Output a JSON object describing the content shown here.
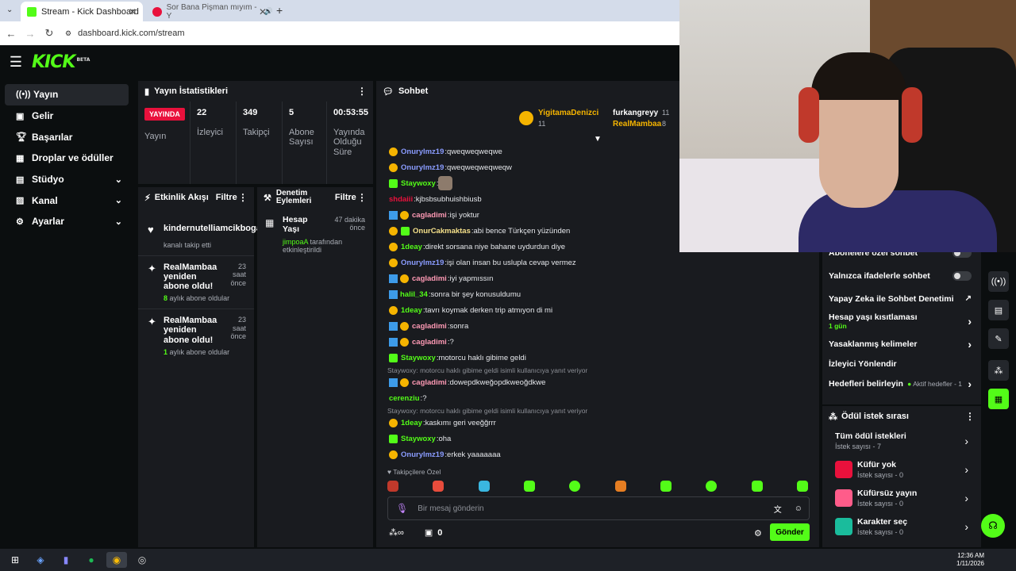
{
  "browser": {
    "tabs": [
      {
        "title": "Stream - Kick Dashboard",
        "active": true
      },
      {
        "title": "Sor Bana Pişman mıyım - Y",
        "active": false
      }
    ],
    "url": "dashboard.kick.com/stream"
  },
  "header": {
    "logo": "KICK",
    "beta": "BETA"
  },
  "sidebar": {
    "items": [
      {
        "label": "Yayın",
        "icon": "broadcast-icon",
        "active": true
      },
      {
        "label": "Gelir",
        "icon": "revenue-icon"
      },
      {
        "label": "Başarılar",
        "icon": "trophy-icon"
      },
      {
        "label": "Droplar ve ödüller",
        "icon": "gift-icon"
      },
      {
        "label": "Stüdyo",
        "icon": "studio-icon",
        "expand": true
      },
      {
        "label": "Kanal",
        "icon": "channel-icon",
        "expand": true
      },
      {
        "label": "Ayarlar",
        "icon": "gear-icon",
        "expand": true
      }
    ]
  },
  "stream_stats": {
    "title": "Yayın İstatistikleri",
    "live": "YAYINDA",
    "live_label": "Yayın",
    "stats": [
      {
        "value": "22",
        "label": "İzleyici"
      },
      {
        "value": "349",
        "label": "Takipçi"
      },
      {
        "value": "5",
        "label": "Abone Sayısı"
      },
      {
        "value": "00:53:55",
        "label": "Yayında Olduğu Süre"
      }
    ]
  },
  "activity": {
    "title": "Etkinlik Akışı",
    "filter": "Filtre",
    "events": [
      {
        "title": "kindernutelliamcikboga",
        "sub": "kanalı takip etti",
        "time": ""
      },
      {
        "title": "RealMambaa yeniden abone oldu!",
        "sub_num": "8",
        "sub": "aylık abone oldular",
        "time": "23 saat önce"
      },
      {
        "title": "RealMambaa yeniden abone oldu!",
        "sub_num": "1",
        "sub": "aylık abone oldular",
        "time": "23 saat önce"
      }
    ]
  },
  "moderation": {
    "title": "Denetim Eylemleri",
    "filter": "Filtre",
    "item": {
      "title": "Hesap Yaşı",
      "time": "47 dakika önce",
      "user": "jimpoaA",
      "sub": "tarafından etkinleştirildi"
    }
  },
  "chat": {
    "title": "Sohbet",
    "gifters": [
      {
        "name": "YigitamaDenizci",
        "count": "11"
      },
      {
        "name": "furkangreyy",
        "count": "11"
      },
      {
        "name": "RealMambaa",
        "count": "8"
      }
    ],
    "messages": [
      {
        "user": "Onurylmz19",
        "color": "#8a9cff",
        "text": "qweqweqweqwe",
        "badge": "gold"
      },
      {
        "user": "Onurylmz19",
        "color": "#8a9cff",
        "text": "qweqweqweqweqw",
        "badge": "gold"
      },
      {
        "user": "Staywoxy",
        "color": "#53fc18",
        "text": "",
        "badge": "green",
        "emote": true
      },
      {
        "user": "shdaiii",
        "color": "#e9113c",
        "text": "kjbsbsubhuishbiusb",
        "badge": ""
      },
      {
        "user": "cagladimi",
        "color": "#ff9ab5",
        "text": "işi yoktur",
        "badge": "blue-gold"
      },
      {
        "user": "OnurCakmaktas",
        "color": "#f5e08a",
        "text": "abi bence Türkçen yüzünden",
        "badge": "gold-green"
      },
      {
        "user": "1deay",
        "color": "#53fc18",
        "text": "direkt sorsana niye bahane uydurdun diye",
        "badge": "gold"
      },
      {
        "user": "Onurylmz19",
        "color": "#8a9cff",
        "text": "işi olan insan bu uslupla cevap vermez",
        "badge": "gold"
      },
      {
        "user": "cagladimi",
        "color": "#ff9ab5",
        "text": "iyi yapmıssın",
        "badge": "blue-gold"
      },
      {
        "user": "halil_34",
        "color": "#53fc18",
        "text": "sonra bir şey konusuldumu",
        "badge": "blue"
      },
      {
        "user": "1deay",
        "color": "#53fc18",
        "text": "tavrı koymak derken trip atmıyon di mi",
        "badge": "gold"
      },
      {
        "user": "cagladimi",
        "color": "#ff9ab5",
        "text": "sonra",
        "badge": "blue-gold"
      },
      {
        "user": "cagladimi",
        "color": "#ff9ab5",
        "text": "?",
        "badge": "blue-gold"
      },
      {
        "user": "Staywoxy",
        "color": "#53fc18",
        "text": "motorcu haklı gibime geldi",
        "badge": "green"
      },
      {
        "reply": "Staywoxy: motorcu haklı gibime geldi isimli kullanıcıya yanıt veriyor",
        "user": "cagladimi",
        "color": "#ff9ab5",
        "text": "dowepdkweğopdkweoğdkwe",
        "badge": "blue-gold"
      },
      {
        "user": "cerenziu",
        "color": "#53fc18",
        "text": "?",
        "badge": ""
      },
      {
        "reply": "Staywoxy: motorcu haklı gibime geldi isimli kullanıcıya yanıt veriyor",
        "user": "1deay",
        "color": "#53fc18",
        "text": "kaskımı geri veeğğrrr",
        "badge": "gold"
      },
      {
        "user": "Staywoxy",
        "color": "#53fc18",
        "text": "oha",
        "badge": "green"
      },
      {
        "user": "Onurylmz19",
        "color": "#8a9cff",
        "text": "erkek yaaaaaaa",
        "badge": "gold"
      }
    ],
    "followers_only": "Takipçilere Özel",
    "input_placeholder": "Bir mesaj gönderin",
    "points": "0",
    "send": "Gönder"
  },
  "settings": {
    "rows": [
      {
        "label": "Abonelere özel sohbet",
        "type": "toggle"
      },
      {
        "label": "Yalnızca ifadelerle sohbet",
        "type": "toggle"
      },
      {
        "label": "Yapay Zeka ile Sohbet Denetimi",
        "type": "ext"
      },
      {
        "label": "Hesap yaşı kısıtlaması",
        "sub": "1 gün",
        "type": "arrow"
      },
      {
        "label": "Yasaklanmış kelimeler",
        "type": "arrow"
      },
      {
        "label": "İzleyici Yönlendir",
        "type": "none"
      },
      {
        "label": "Hedefleri belirleyin",
        "extra": "Aktif hedefler - 1",
        "type": "arrow"
      }
    ]
  },
  "rewards": {
    "title": "Ödül istek sırası",
    "all": {
      "label": "Tüm ödül istekleri",
      "sub": "İstek sayısı - 7"
    },
    "items": [
      {
        "label": "Küfür yok",
        "sub": "İstek sayısı - 0"
      },
      {
        "label": "Küfürsüz yayın",
        "sub": "İstek sayısı - 0"
      },
      {
        "label": "Karakter seç",
        "sub": "İstek sayısı - 0"
      }
    ]
  },
  "taskbar": {
    "time": "12:36 AM",
    "date": "1/11/2026"
  },
  "colors": {
    "accent": "#53fc18",
    "panel": "#191b1f",
    "live": "#e9113c"
  }
}
